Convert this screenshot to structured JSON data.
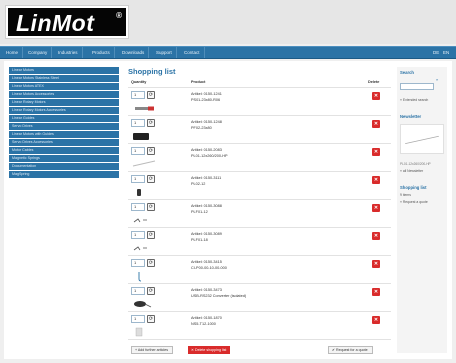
{
  "brand": {
    "name": "LinMot",
    "reg": "®"
  },
  "nav": {
    "items": [
      "Home",
      "Company",
      "Industries",
      "Products",
      "Downloads",
      "Support",
      "Contact"
    ],
    "right": [
      "DE",
      "EN"
    ]
  },
  "sidebar": {
    "items": [
      "Linear Motors",
      "Linear Motors Stainless Steel",
      "Linear Motors ATEX",
      "Linear Motors Accessories",
      "Linear Rotary Motors",
      "Linear Rotary Motors Accessories",
      "Linear Guides",
      "Servo Drives",
      "Linear Motors with Guides",
      "Servo Drives Accessories",
      "Motor Cables",
      "Magnetic Springs",
      "Documentation",
      "MagSpring"
    ]
  },
  "cart": {
    "title": "Shopping list",
    "headers": {
      "quantity": "Quantity",
      "product": "Product",
      "delete": "Delete"
    },
    "items": [
      {
        "qty": "1",
        "article": "Artikel: 0150-1241",
        "name": "PS01-23x80-R06"
      },
      {
        "qty": "1",
        "article": "Artikel: 0150-1248",
        "name": "PF02-23x80"
      },
      {
        "qty": "1",
        "article": "Artikel: 0150-2083",
        "name": "PL01-12x260/200-HP"
      },
      {
        "qty": "1",
        "article": "Artikel: 0150-3111",
        "name": "PL02-12"
      },
      {
        "qty": "1",
        "article": "Artikel: 0150-3088",
        "name": "PLF01-12"
      },
      {
        "qty": "1",
        "article": "Artikel: 0150-3089",
        "name": "PLF01-18"
      },
      {
        "qty": "1",
        "article": "Artikel: 0150-3415",
        "name": "CI-P00-00-10-00-000"
      },
      {
        "qty": "1",
        "article": "Artikel: 0150-3473",
        "name": "USB-RS232 Converter (isolated)"
      },
      {
        "qty": "1",
        "article": "Artikel: 0150-1870",
        "name": "NS5-T12-1000"
      }
    ],
    "actions": {
      "add": "Add further articles",
      "clear": "Delete shopping list",
      "request": "Request for a quote"
    }
  },
  "right": {
    "search": {
      "heading": "Search",
      "go": "»",
      "link": "» Extended search"
    },
    "newsletter": {
      "heading": "Newsletter",
      "caption": "PL01-12x260/200-HP",
      "link": "» all Newsletter"
    },
    "shopping": {
      "heading": "Shopping list",
      "count": "9 items",
      "link": "» Request a quote"
    }
  },
  "colors": {
    "brand_blue": "#2b73a6",
    "delete_red": "#d92b2b",
    "logo_bg": "#050505"
  }
}
